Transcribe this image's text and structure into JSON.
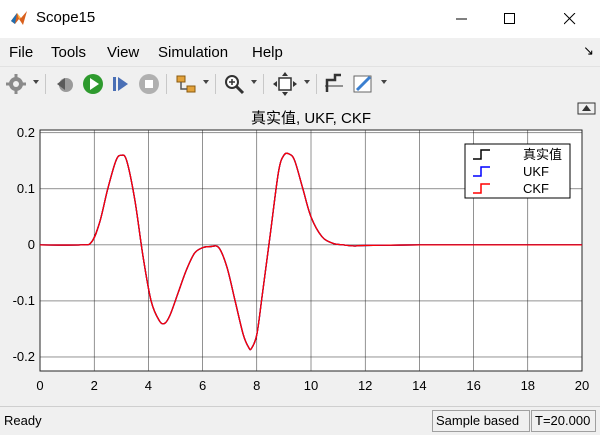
{
  "window": {
    "title": "Scope15"
  },
  "menu": [
    "File",
    "Tools",
    "View",
    "Simulation",
    "Help"
  ],
  "toolbar": {
    "icons": [
      "gear-icon",
      "step-back-icon",
      "run-icon",
      "step-forward-icon",
      "stop-icon",
      "signal-select-icon",
      "zoom-icon",
      "fit-axes-icon",
      "cursor-measure-icon",
      "highlight-icon"
    ]
  },
  "plot": {
    "title": "真实值, UKF, CKF",
    "background": "#ffffff"
  },
  "chart_data": {
    "type": "line",
    "title": "真实值, UKF, CKF",
    "xlabel": "",
    "ylabel": "",
    "xlim": [
      0,
      20
    ],
    "ylim": [
      -0.225,
      0.205
    ],
    "xticks": [
      0,
      2,
      4,
      6,
      8,
      10,
      12,
      14,
      16,
      18,
      20
    ],
    "yticks": [
      0.2,
      0.1,
      0,
      -0.1,
      -0.2
    ],
    "xtick_labels": [
      "0",
      "2",
      "4",
      "6",
      "8",
      "10",
      "12",
      "14",
      "16",
      "18",
      "20"
    ],
    "ytick_labels": [
      "0.2",
      "0.1",
      "0",
      "-0.1",
      "-0.2"
    ],
    "grid": true,
    "legend_position": "top-right",
    "series": [
      {
        "name": "真实值",
        "color": "#000000"
      },
      {
        "name": "UKF",
        "color": "#0000ff"
      },
      {
        "name": "CKF",
        "color": "#ff0000"
      }
    ],
    "x": [
      0,
      1.5,
      1.9,
      2.2,
      2.5,
      2.8,
      3.0,
      3.2,
      3.5,
      3.8,
      4.1,
      4.4,
      4.6,
      4.8,
      5.1,
      5.4,
      5.7,
      6.0,
      6.3,
      6.6,
      6.9,
      7.2,
      7.5,
      7.7,
      7.8,
      8.0,
      8.2,
      8.5,
      8.8,
      9.0,
      9.2,
      9.4,
      9.7,
      10.0,
      10.4,
      10.8,
      11.2,
      11.6,
      12.0,
      14,
      16,
      18,
      20
    ],
    "values": [
      0,
      0.0,
      0.005,
      0.04,
      0.1,
      0.15,
      0.16,
      0.15,
      0.08,
      -0.02,
      -0.1,
      -0.135,
      -0.14,
      -0.125,
      -0.085,
      -0.045,
      -0.015,
      -0.005,
      -0.003,
      -0.005,
      -0.04,
      -0.1,
      -0.16,
      -0.183,
      -0.185,
      -0.16,
      -0.09,
      0.02,
      0.13,
      0.16,
      0.162,
      0.15,
      0.1,
      0.05,
      0.015,
      0.003,
      0.0,
      -0.002,
      -0.001,
      0.0,
      0.0,
      0.0,
      0.0
    ]
  },
  "status": {
    "ready": "Ready",
    "mode": "Sample based",
    "time": "T=20.000"
  }
}
